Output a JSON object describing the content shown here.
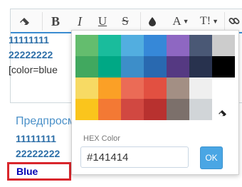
{
  "toolbar": {
    "bold": "B",
    "italic": "I",
    "underline": "U",
    "strike": "S",
    "font": "A",
    "size": "T!"
  },
  "editor": {
    "line1": "11111111",
    "line2": "22222222",
    "line3": "[color=blue"
  },
  "preview": {
    "title": "Предпросм",
    "line1": "11111111",
    "line2": "22222222",
    "line3": "Blue"
  },
  "picker": {
    "swatches": [
      "#64bd6e",
      "#1abc9c",
      "#52aee0",
      "#3688d8",
      "#8e67c2",
      "#4a5875",
      "#cccccc",
      "#41a85f",
      "#00a885",
      "#3d8ec9",
      "#2969b0",
      "#553982",
      "#28324e",
      "#000000",
      "#f7da64",
      "#fba026",
      "#eb6b56",
      "#e25041",
      "#a38f84",
      "#efefef",
      "#ffffff",
      "#fac51c",
      "#f37934",
      "#d14841",
      "#b8312f",
      "#7c706b",
      "#d1d5d8",
      ""
    ],
    "hex_label": "HEX Color",
    "hex_value": "#141414",
    "ok_label": "OK"
  }
}
